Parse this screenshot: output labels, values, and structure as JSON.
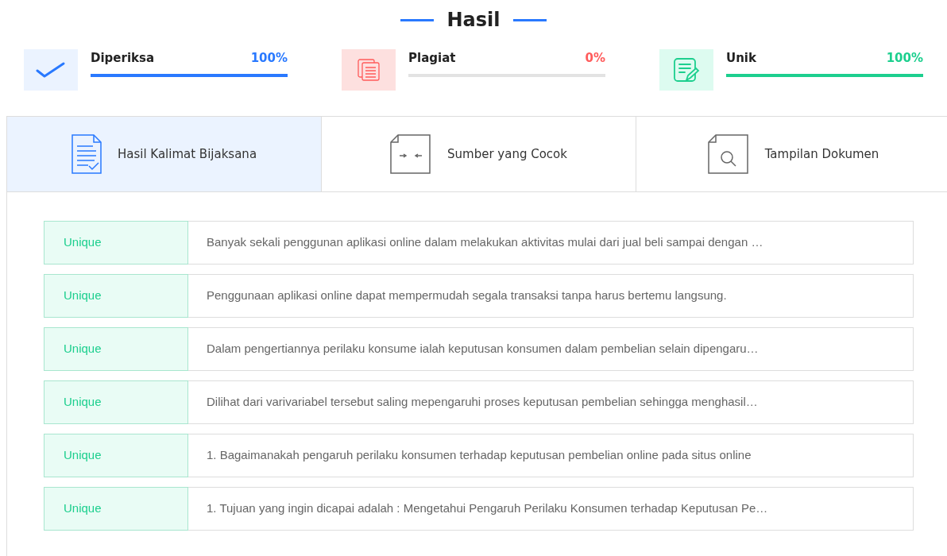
{
  "title": "Hasil",
  "stats": [
    {
      "label": "Diperiksa",
      "value": "100%",
      "level": 1,
      "kind": "checked",
      "color": "#2979ff"
    },
    {
      "label": "Plagiat",
      "value": "0%",
      "level": 0,
      "kind": "plagiat",
      "color": "#ff5b5b"
    },
    {
      "label": "Unik",
      "value": "100%",
      "level": 1,
      "kind": "unique",
      "color": "#1ccf8e"
    }
  ],
  "tabs": [
    {
      "label": "Hasil Kalimat Bijaksana",
      "selected": true,
      "kind": "sentences"
    },
    {
      "label": "Sumber yang Cocok",
      "selected": false,
      "kind": "sources"
    },
    {
      "label": "Tampilan Dokumen",
      "selected": false,
      "kind": "document"
    }
  ],
  "rows": [
    {
      "status": "Unique",
      "text": "Banyak sekali penggunan aplikasi online dalam melakukan aktivitas mulai dari jual beli sampai dengan …"
    },
    {
      "status": "Unique",
      "text": "Penggunaan aplikasi online dapat mempermudah segala transaksi tanpa harus bertemu langsung."
    },
    {
      "status": "Unique",
      "text": "Dalam pengertiannya perilaku konsume ialah keputusan konsumen dalam pembelian selain dipengaru…"
    },
    {
      "status": "Unique",
      "text": "Dilihat dari varivariabel tersebut saling mepengaruhi proses keputusan pembelian sehingga menghasil…"
    },
    {
      "status": "Unique",
      "text": "1. Bagaimanakah pengaruh perilaku konsumen terhadap keputusan pembelian online pada situs online"
    },
    {
      "status": "Unique",
      "text": "1. Tujuan yang ingin dicapai adalah : Mengetahui Pengaruh Perilaku Konsumen terhadap Keputusan Pe…"
    }
  ]
}
